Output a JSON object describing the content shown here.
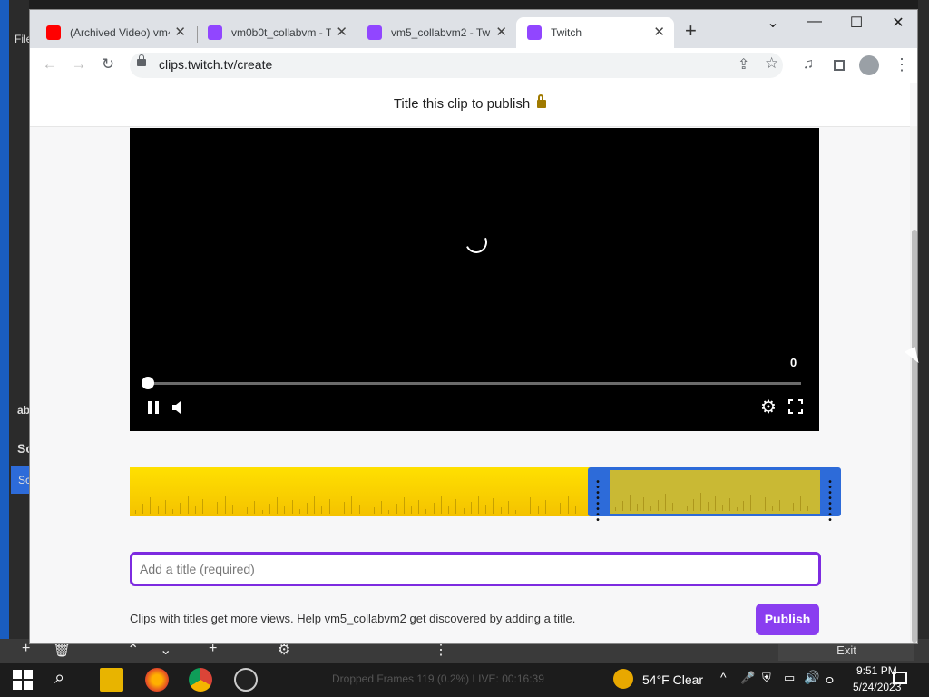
{
  "obs": {
    "left_fragments": [
      "File",
      "ab",
      "Sc",
      "Sc"
    ],
    "exit_label": "Exit",
    "status": "Dropped Frames 119 (0.2%)     LIVE: 00:16:39"
  },
  "browser": {
    "tabs": [
      {
        "label": "(Archived Video) vm4",
        "favicon": "youtube-icon",
        "color": "#ff0000"
      },
      {
        "label": "vm0b0t_collabvm - T",
        "favicon": "twitch-icon",
        "color": "#9146ff"
      },
      {
        "label": "vm5_collabvm2 - Tw",
        "favicon": "twitch-icon",
        "color": "#9146ff"
      },
      {
        "label": "Twitch",
        "favicon": "twitch-icon",
        "color": "#9146ff"
      }
    ],
    "new_tab_label": "+",
    "url": "clips.twitch.tv/create"
  },
  "page": {
    "title": "Title this clip to publish",
    "player": {
      "time": "0",
      "gear_glyph": "⚙"
    },
    "title_input": {
      "value": "",
      "placeholder": "Add a title (required)"
    },
    "hint": "Clips with titles get more views. Help vm5_collabvm2 get discovered by adding a title.",
    "publish_label": "Publish"
  },
  "taskbar": {
    "weather": "54°F  Clear",
    "time": "9:51 PM",
    "date": "5/24/2023"
  },
  "colors": {
    "accent": "#8a3ef0",
    "timeline_yellow": "#ffe000",
    "selection_blue": "#2d6bd9"
  }
}
